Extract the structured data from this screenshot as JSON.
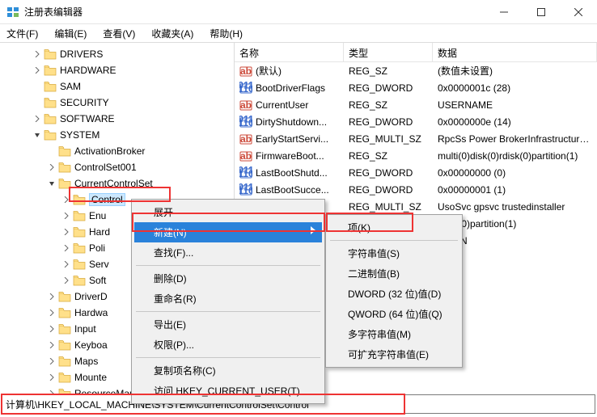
{
  "titlebar": {
    "title": "注册表编辑器"
  },
  "menubar": [
    "文件(F)",
    "编辑(E)",
    "查看(V)",
    "收藏夹(A)",
    "帮助(H)"
  ],
  "tree": [
    {
      "d": 2,
      "c": ">",
      "t": "DRIVERS"
    },
    {
      "d": 2,
      "c": ">",
      "t": "HARDWARE"
    },
    {
      "d": 2,
      "c": "",
      "t": "SAM"
    },
    {
      "d": 2,
      "c": "",
      "t": "SECURITY"
    },
    {
      "d": 2,
      "c": ">",
      "t": "SOFTWARE"
    },
    {
      "d": 2,
      "c": "v",
      "t": "SYSTEM"
    },
    {
      "d": 3,
      "c": "",
      "t": "ActivationBroker"
    },
    {
      "d": 3,
      "c": ">",
      "t": "ControlSet001"
    },
    {
      "d": 3,
      "c": "v",
      "t": "CurrentControlSet"
    },
    {
      "d": 4,
      "c": ">",
      "t": "Control",
      "sel": true
    },
    {
      "d": 4,
      "c": ">",
      "t": "Enu"
    },
    {
      "d": 4,
      "c": ">",
      "t": "Hard"
    },
    {
      "d": 4,
      "c": ">",
      "t": "Poli"
    },
    {
      "d": 4,
      "c": ">",
      "t": "Serv"
    },
    {
      "d": 4,
      "c": ">",
      "t": "Soft"
    },
    {
      "d": 3,
      "c": ">",
      "t": "DriverD"
    },
    {
      "d": 3,
      "c": ">",
      "t": "Hardwa"
    },
    {
      "d": 3,
      "c": ">",
      "t": "Input"
    },
    {
      "d": 3,
      "c": ">",
      "t": "Keyboa"
    },
    {
      "d": 3,
      "c": ">",
      "t": "Maps"
    },
    {
      "d": 3,
      "c": ">",
      "t": "Mounte"
    },
    {
      "d": 3,
      "c": ">",
      "t": "ResourceManager"
    }
  ],
  "columns": {
    "name": "名称",
    "type": "类型",
    "data": "数据"
  },
  "values": [
    {
      "k": "sz",
      "n": "(默认)",
      "t": "REG_SZ",
      "d": "(数值未设置)"
    },
    {
      "k": "dw",
      "n": "BootDriverFlags",
      "t": "REG_DWORD",
      "d": "0x0000001c (28)"
    },
    {
      "k": "sz",
      "n": "CurrentUser",
      "t": "REG_SZ",
      "d": "USERNAME"
    },
    {
      "k": "dw",
      "n": "DirtyShutdown...",
      "t": "REG_DWORD",
      "d": "0x0000000e (14)"
    },
    {
      "k": "ms",
      "n": "EarlyStartServi...",
      "t": "REG_MULTI_SZ",
      "d": "RpcSs Power BrokerInfrastructure S"
    },
    {
      "k": "sz",
      "n": "FirmwareBoot...",
      "t": "REG_SZ",
      "d": "multi(0)disk(0)rdisk(0)partition(1)"
    },
    {
      "k": "dw",
      "n": "LastBootShutd...",
      "t": "REG_DWORD",
      "d": "0x00000000 (0)"
    },
    {
      "k": "dw",
      "n": "LastBootSucce...",
      "t": "REG_DWORD",
      "d": "0x00000001 (1)"
    },
    {
      "k": "ms",
      "n": "",
      "t": "REG_MULTI_SZ",
      "d": "UsoSvc gpsvc trustedinstaller"
    },
    {
      "k": "",
      "n": "",
      "t": "",
      "d": "rdisk(0)partition(1)"
    },
    {
      "k": "",
      "n": "",
      "t": "",
      "d": "OPTIN"
    }
  ],
  "ctx1": [
    {
      "t": "展开"
    },
    {
      "t": "新建(N)",
      "arrow": true,
      "hover": true
    },
    {
      "t": "查找(F)..."
    },
    {
      "sep": true
    },
    {
      "t": "删除(D)"
    },
    {
      "t": "重命名(R)"
    },
    {
      "sep": true
    },
    {
      "t": "导出(E)"
    },
    {
      "t": "权限(P)..."
    },
    {
      "sep": true
    },
    {
      "t": "复制项名称(C)"
    },
    {
      "t": "访问 HKEY_CURRENT_USER(T)"
    }
  ],
  "ctx2": [
    {
      "t": "项(K)"
    },
    {
      "sep": true
    },
    {
      "t": "字符串值(S)"
    },
    {
      "t": "二进制值(B)"
    },
    {
      "t": "DWORD (32 位)值(D)"
    },
    {
      "t": "QWORD (64 位)值(Q)"
    },
    {
      "t": "多字符串值(M)"
    },
    {
      "t": "可扩充字符串值(E)"
    }
  ],
  "path": "计算机\\HKEY_LOCAL_MACHINE\\SYSTEM\\CurrentControlSet\\Control"
}
